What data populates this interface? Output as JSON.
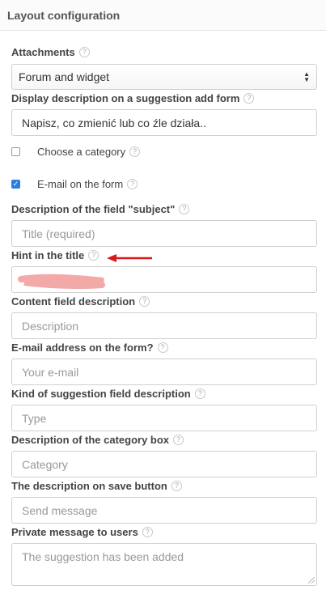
{
  "header": {
    "title": "Layout configuration"
  },
  "fields": {
    "attachments": {
      "label": "Attachments",
      "value": "Forum and widget"
    },
    "display_description": {
      "label": "Display description on a suggestion add form",
      "value": "Napisz, co zmienić lub co źle działa.."
    },
    "choose_category": {
      "label": "Choose a category",
      "checked": false
    },
    "email_on_form": {
      "label": "E-mail on the form",
      "checked": true
    },
    "subject_description": {
      "label": "Description of the field \"subject\"",
      "placeholder": "Title (required)"
    },
    "hint_in_title": {
      "label": "Hint in the title",
      "value": ""
    },
    "content_description": {
      "label": "Content field description",
      "placeholder": "Description"
    },
    "email_address": {
      "label": "E-mail address on the form?",
      "placeholder": "Your e-mail"
    },
    "kind_description": {
      "label": "Kind of suggestion field description",
      "placeholder": "Type"
    },
    "category_box": {
      "label": "Description of the category box",
      "placeholder": "Category"
    },
    "save_button": {
      "label": "The description on save button",
      "placeholder": "Send message"
    },
    "private_message": {
      "label": "Private message to users",
      "placeholder": "The suggestion has been added"
    }
  },
  "help_glyph": "?",
  "colors": {
    "annotation_arrow": "#d7191c",
    "redaction": "#f4a9a9",
    "checkbox_accent": "#2a7fe4"
  }
}
